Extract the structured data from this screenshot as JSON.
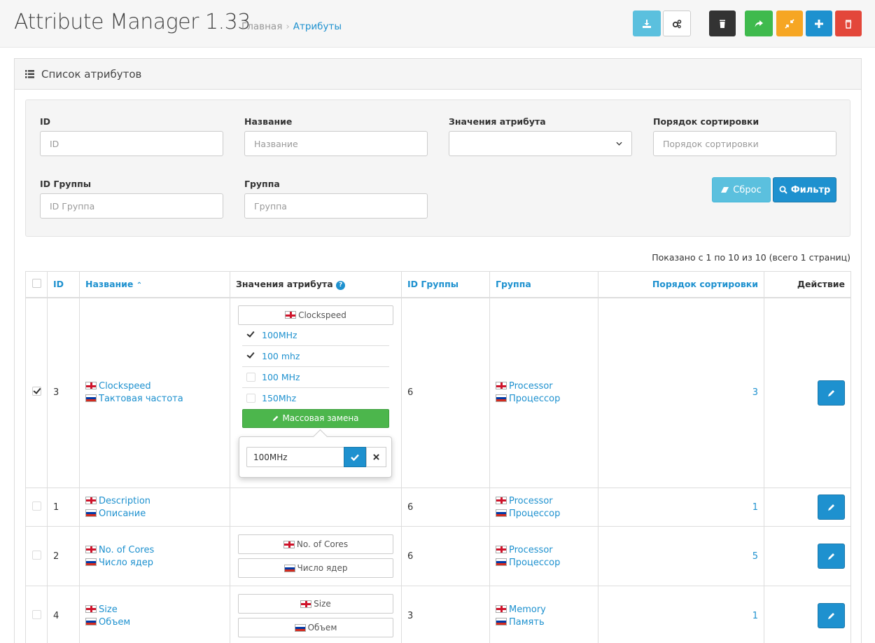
{
  "header": {
    "title": "Attribute Manager 1.33",
    "breadcrumb": {
      "home": "Главная",
      "sep": "›",
      "current": "Атрибуты"
    },
    "buttons": [
      {
        "name": "download-button",
        "icon": "download-icon",
        "color": "#5bc0de"
      },
      {
        "name": "settings-button",
        "icon": "gears-icon",
        "color": "#ffffff"
      },
      {
        "name": "delete-all-button",
        "icon": "trash-icon",
        "color": "#333333"
      },
      {
        "name": "share-button",
        "icon": "share-icon",
        "color": "#3fba4d"
      },
      {
        "name": "compress-button",
        "icon": "compress-icon",
        "color": "#f6a623"
      },
      {
        "name": "add-button",
        "icon": "plus-icon",
        "color": "#1e91cf"
      },
      {
        "name": "delete-button",
        "icon": "trash-icon",
        "color": "#e3473a"
      }
    ]
  },
  "panel": {
    "title": "Список атрибутов"
  },
  "filter": {
    "id_label": "ID",
    "id_placeholder": "ID",
    "name_label": "Название",
    "name_placeholder": "Название",
    "values_label": "Значения атрибута",
    "values_selected": "",
    "sort_label": "Порядок сортировки",
    "sort_placeholder": "Порядок сортировки",
    "group_id_label": "ID Группы",
    "group_id_placeholder": "ID Группа",
    "group_label": "Группа",
    "group_placeholder": "Группа",
    "reset_label": "Сброс",
    "filter_label": "Фильтр"
  },
  "pagination": {
    "info": "Показано с 1 по 10 из 10 (всего 1 страниц)"
  },
  "table": {
    "headers": {
      "id": "ID",
      "name": "Название",
      "name_sort": "⌃",
      "values": "Значения атрибута",
      "values_help": "?",
      "group_id": "ID Группы",
      "group": "Группа",
      "sort": "Порядок сортировки",
      "action": "Действие"
    },
    "rows": [
      {
        "checked": true,
        "id": "3",
        "name_en": "Clockspeed",
        "name_ru": "Тактовая частота",
        "values_header": "Clockspeed",
        "values": [
          {
            "label": "100MHz",
            "checked": true
          },
          {
            "label": "100 mhz",
            "checked": true
          },
          {
            "label": "100 MHz",
            "checked": false
          },
          {
            "label": "150Mhz",
            "checked": false
          }
        ],
        "mass_replace_label": "Массовая замена",
        "replace_value": "100MHz",
        "group_id": "6",
        "group_en": "Processor",
        "group_ru": "Процессор",
        "sort": "3"
      },
      {
        "checked": false,
        "id": "1",
        "name_en": "Description",
        "name_ru": "Описание",
        "group_id": "6",
        "group_en": "Processor",
        "group_ru": "Процессор",
        "sort": "1"
      },
      {
        "checked": false,
        "id": "2",
        "name_en": "No. of Cores",
        "name_ru": "Число ядер",
        "value_en": "No. of Cores",
        "value_ru": "Число ядер",
        "group_id": "6",
        "group_en": "Processor",
        "group_ru": "Процессор",
        "sort": "5"
      },
      {
        "checked": false,
        "id": "4",
        "name_en": "Size",
        "name_ru": "Объем",
        "value_en": "Size",
        "value_ru": "Объем",
        "group_id": "3",
        "group_en": "Memory",
        "group_ru": "Память",
        "sort": "1"
      }
    ]
  }
}
